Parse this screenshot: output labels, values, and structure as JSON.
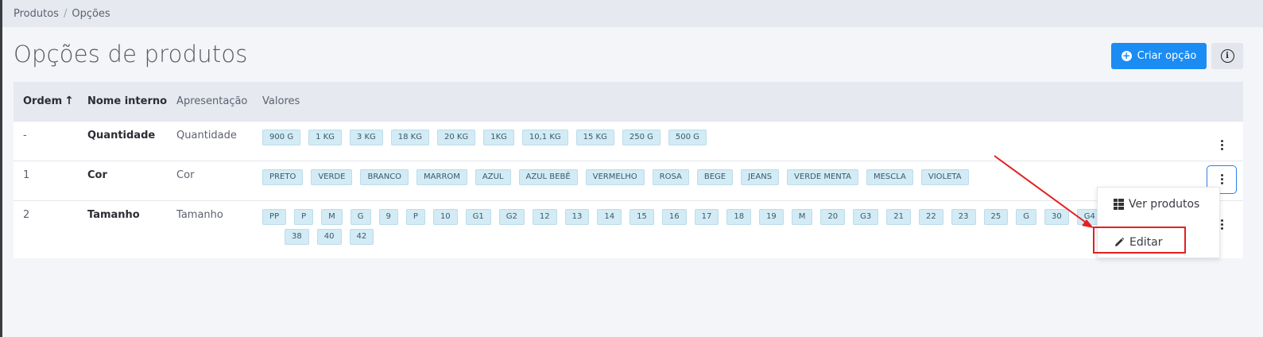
{
  "breadcrumb": {
    "items": [
      "Produtos",
      "Opções"
    ],
    "separator": "/"
  },
  "page": {
    "title": "Opções de produtos"
  },
  "toolbar": {
    "create_label": "Criar opção",
    "create_icon": "plus-circle-icon",
    "info_icon": "info-icon"
  },
  "table": {
    "headers": {
      "ordem": "Ordem",
      "nome": "Nome interno",
      "apresentacao": "Apresentação",
      "valores": "Valores"
    },
    "sort_indicator": "↑",
    "rows": [
      {
        "ordem": "-",
        "nome": "Quantidade",
        "apresentacao": "Quantidade",
        "valores": [
          "900 G",
          "1 KG",
          "3 KG",
          "18 KG",
          "20 KG",
          "1KG",
          "10,1 KG",
          "15 KG",
          "250 G",
          "500 G"
        ]
      },
      {
        "ordem": "1",
        "nome": "Cor",
        "apresentacao": "Cor",
        "valores": [
          "PRETO",
          "VERDE",
          "BRANCO",
          "MARROM",
          "AZUL",
          "AZUL BEBÊ",
          "VERMELHO",
          "ROSA",
          "BEGE",
          "JEANS",
          "VERDE MENTA",
          "MESCLA",
          "VIOLETA"
        ]
      },
      {
        "ordem": "2",
        "nome": "Tamanho",
        "apresentacao": "Tamanho",
        "valores": [
          "PP",
          "P",
          "M",
          "G",
          "9",
          "P",
          "10",
          "G1",
          "G2",
          "12",
          "13",
          "14",
          "15",
          "16",
          "17",
          "18",
          "19",
          "M",
          "20",
          "G3",
          "21",
          "22",
          "23",
          "25",
          "G",
          "30",
          "G4",
          "",
          "",
          "",
          "",
          "38",
          "40",
          "42"
        ]
      }
    ]
  },
  "dropdown": {
    "items": [
      {
        "label": "Ver produtos",
        "icon": "grid-list-icon"
      },
      {
        "label": "Editar",
        "icon": "pencil-icon"
      }
    ]
  },
  "colors": {
    "primary": "#1a8cf3",
    "tag_bg": "#d3ebf5",
    "annotation": "#e52020",
    "header_bg": "#e6e9f0"
  }
}
